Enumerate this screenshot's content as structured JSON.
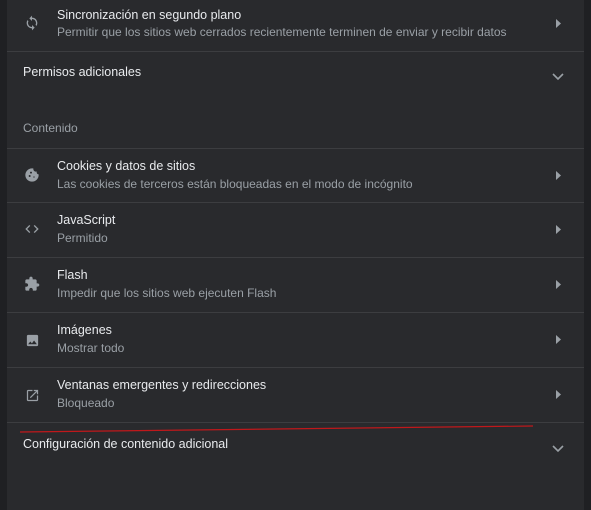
{
  "sync_row": {
    "icon": "sync-icon",
    "title": "Sincronización en segundo plano",
    "subtitle": "Permitir que los sitios web cerrados recientemente terminen de enviar y recibir datos"
  },
  "additional_permissions": {
    "label": "Permisos adicionales",
    "icon": "chevron-down-icon"
  },
  "content_section": {
    "header": "Contenido",
    "items": [
      {
        "icon": "cookie-icon",
        "title": "Cookies y datos de sitios",
        "subtitle": "Las cookies de terceros están bloqueadas en el modo de incógnito"
      },
      {
        "icon": "code-icon",
        "title": "JavaScript",
        "subtitle": "Permitido"
      },
      {
        "icon": "puzzle-icon",
        "title": "Flash",
        "subtitle": "Impedir que los sitios web ejecuten Flash"
      },
      {
        "icon": "image-icon",
        "title": "Imágenes",
        "subtitle": "Mostrar todo"
      },
      {
        "icon": "open-in-new-icon",
        "title": "Ventanas emergentes y redirecciones",
        "subtitle": "Bloqueado"
      }
    ]
  },
  "additional_content_settings": {
    "label": "Configuración de contenido adicional",
    "icon": "chevron-down-icon"
  },
  "colors": {
    "background": "#292a2d",
    "text_primary": "#e8eaed",
    "text_secondary": "#9aa0a6",
    "divider": "#3c3d40",
    "annotation_line": "#c0181b"
  }
}
